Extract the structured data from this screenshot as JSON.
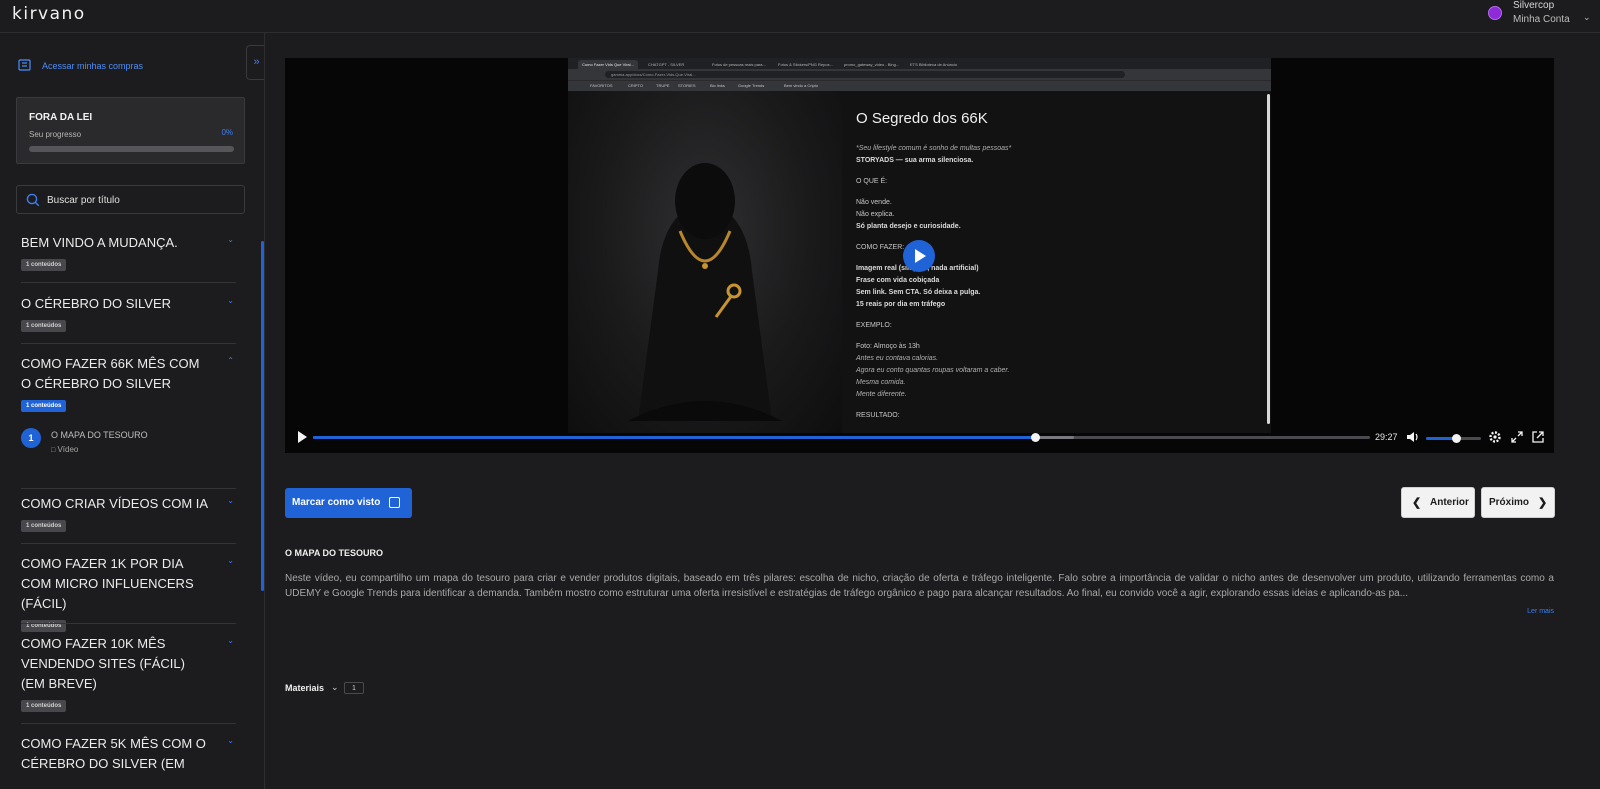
{
  "app": {
    "logo": "KIRVANO"
  },
  "account": {
    "name": "Silvercop",
    "subtitle": "Minha Conta",
    "avatar_color": "#8e2ad8"
  },
  "sidebar": {
    "collapse_icon": "double-chevron-right-icon",
    "purchases_link": "Acessar minhas compras",
    "course": {
      "title": "FORA DA LEI",
      "progress_label": "Seu progresso",
      "progress_text": "0%",
      "progress_value": 0
    },
    "search": {
      "placeholder": "Buscar por título"
    },
    "modules": [
      {
        "title": "BEM VINDO A MUDANÇA.",
        "badge": "1 conteúdos",
        "expanded": false
      },
      {
        "title": "O CÉREBRO DO SILVER",
        "badge": "1 conteúdos",
        "expanded": false
      },
      {
        "title": "COMO FAZER 66K MÊS COM O CÉREBRO DO SILVER",
        "badge": "1 conteúdos",
        "expanded": true
      },
      {
        "title": "COMO CRIAR VÍDEOS COM IA",
        "badge": "1 conteúdos",
        "expanded": false
      },
      {
        "title": "COMO FAZER 1K POR DIA COM MICRO INFLUENCERS (FÁCIL)",
        "badge": "1 conteúdos",
        "expanded": false
      },
      {
        "title": "COMO FAZER 10K MÊS VENDENDO SITES (FÁCIL) (EM BREVE)",
        "badge": "1 conteúdos",
        "expanded": false
      },
      {
        "title": "COMO FAZER 5K MÊS COM O CÉREBRO DO SILVER (EM",
        "badge": "",
        "expanded": false
      }
    ],
    "active_lesson": {
      "number": "1",
      "title": "O MAPA DO TESOURO",
      "type": "Vídeo"
    }
  },
  "video": {
    "browser": {
      "tabs": [
        "Como Fazer Vids Que Viral...",
        "CHATGPT - SILVER",
        "Fotos de pessoas reais para...",
        "Fotos & Stickers/PNG Repos...",
        "promo_gateway_video - Bing...",
        "ETS Biblioteca de Anúncio"
      ],
      "url": "gamma.app/docs/Como-Fazer-Vids-Que-Viral...",
      "bookmarks": [
        "FAVORITOS",
        "CRIPTO",
        "TRUPE",
        "STORIES",
        "Bio links",
        "Google Trends",
        "Bem vindo a Cripto"
      ]
    },
    "slide": {
      "title": "O Segredo dos 66K",
      "lines": [
        {
          "text": "*Seu lifestyle comum é sonho de multas pessoas*",
          "style": "i"
        },
        {
          "text": "STORYADS — sua arma silenciosa.",
          "style": "b"
        },
        {
          "text": "O QUE É:",
          "style": "gap"
        },
        {
          "text": "Não vende.",
          "style": "gap"
        },
        {
          "text": "Não explica.",
          "style": ""
        },
        {
          "text": "Só planta desejo e curiosidade.",
          "style": "b"
        },
        {
          "text": "COMO FAZER:",
          "style": "gap"
        },
        {
          "text": "Imagem real (simples, nada artificial)",
          "style": "gap b"
        },
        {
          "text": "Frase com vida cobiçada",
          "style": "b"
        },
        {
          "text": "Sem link. Sem CTA. Só deixa a pulga.",
          "style": "b"
        },
        {
          "text": "15 reais por dia em tráfego",
          "style": "b"
        },
        {
          "text": "EXEMPLO:",
          "style": "gap"
        },
        {
          "text": "Foto: Almoço às 13h",
          "style": "gap"
        },
        {
          "text": "Antes eu contava calorias.",
          "style": "i"
        },
        {
          "text": "Agora eu conto quantas roupas voltaram a caber.",
          "style": "i"
        },
        {
          "text": "Mesma comida.",
          "style": "i"
        },
        {
          "text": "Mente diferente.",
          "style": "i"
        },
        {
          "text": "RESULTADO:",
          "style": "gap"
        }
      ]
    },
    "controls": {
      "time": "29:27",
      "progress": 0.683,
      "buffered": 0.72,
      "volume": 0.55,
      "icons": [
        "play-icon",
        "volume-icon",
        "settings-icon",
        "fullscreen-icon",
        "popout-icon"
      ]
    }
  },
  "actions": {
    "mark_seen": "Marcar como visto",
    "prev": "Anterior",
    "next": "Próximo"
  },
  "lesson": {
    "title": "O MAPA DO TESOURO",
    "description": "Neste vídeo, eu compartilho um mapa do tesouro para criar e vender produtos digitais, baseado em três pilares: escolha de nicho, criação de oferta e tráfego inteligente. Falo sobre a importância de validar o nicho antes de desenvolver um produto, utilizando ferramentas como a UDEMY e Google Trends para identificar a demanda. Também mostro como estruturar uma oferta irresistível e estratégias de tráfego orgânico e pago para alcançar resultados. Ao final, eu convido você a agir, explorando essas ideias e aplicando-as pa...",
    "read_more": "Ler mais",
    "materials_label": "Materiais",
    "materials_count": "1"
  },
  "colors": {
    "accent": "#1f63d6",
    "background": "#1c1c1e",
    "link": "#3d7ef0"
  }
}
